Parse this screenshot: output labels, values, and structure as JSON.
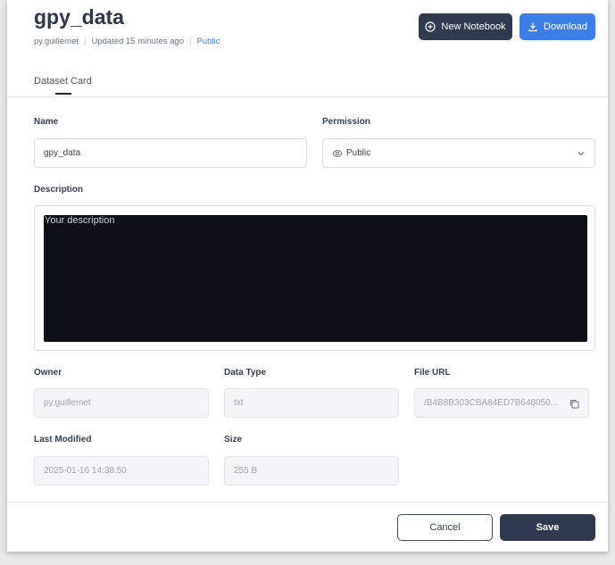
{
  "header": {
    "title": "gpy_data",
    "owner": "py.guillemet",
    "updated": "Updated 15 minutes ago",
    "separator": "|",
    "visibility": "Public",
    "new_notebook_label": "New Notebook",
    "download_label": "Download"
  },
  "tabs": [
    {
      "label": "Dataset Card",
      "active": true
    }
  ],
  "form": {
    "name_label": "Name",
    "name_value": "gpy_data",
    "permission_label": "Permission",
    "permission_value": "Public",
    "description_label": "Description",
    "description_placeholder": "Your description",
    "owner_label": "Owner",
    "owner_value": "py.guillemet",
    "data_type_label": "Data Type",
    "data_type_value": "txt",
    "file_url_label": "File URL",
    "file_url_value": "/B4B8B303CBA84ED7B648050...",
    "last_modified_label": "Last Modified",
    "last_modified_value": "2025-01-16 14:38:50",
    "size_label": "Size",
    "size_value": "255 B"
  },
  "footer": {
    "cancel_label": "Cancel",
    "save_label": "Save"
  },
  "colors": {
    "primary_dark": "#2f3a4f",
    "accent_blue": "#3b7fe6",
    "editor_bg": "#0d1117"
  },
  "icons": {
    "new_notebook": "plus-circle-icon",
    "download": "download-icon",
    "permission": "eye-icon",
    "permission_dropdown": "chevron-down-icon",
    "file_url_action": "copy-icon"
  }
}
